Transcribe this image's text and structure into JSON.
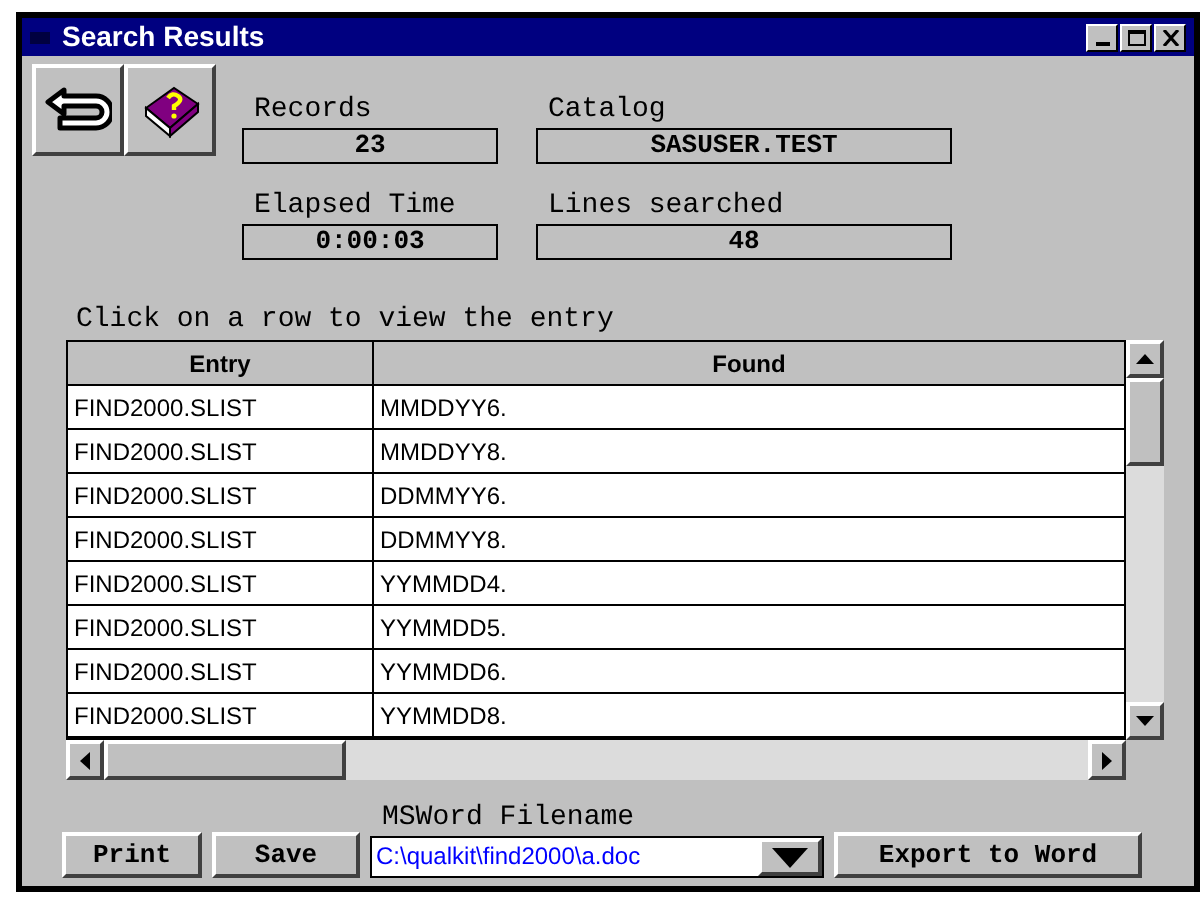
{
  "window": {
    "title": "Search Results"
  },
  "stats": [
    {
      "label": "Records",
      "value": "23"
    },
    {
      "label": "Catalog",
      "value": "SASUSER.TEST"
    },
    {
      "label": "Elapsed Time",
      "value": "0:00:03"
    },
    {
      "label": "Lines searched",
      "value": "48"
    }
  ],
  "instruction": "Click on a row to view the entry",
  "table": {
    "columns": [
      "Entry",
      "Found"
    ],
    "rows": [
      [
        "FIND2000.SLIST",
        "MMDDYY6."
      ],
      [
        "FIND2000.SLIST",
        "MMDDYY8."
      ],
      [
        "FIND2000.SLIST",
        "DDMMYY6."
      ],
      [
        "FIND2000.SLIST",
        "DDMMYY8."
      ],
      [
        "FIND2000.SLIST",
        "YYMMDD4."
      ],
      [
        "FIND2000.SLIST",
        "YYMMDD5."
      ],
      [
        "FIND2000.SLIST",
        "YYMMDD6."
      ],
      [
        "FIND2000.SLIST",
        "YYMMDD8."
      ]
    ]
  },
  "buttons": [
    "Print",
    "Save"
  ],
  "filename": {
    "label": "MSWord Filename",
    "value": "C:\\qualkit\\find2000\\a.doc"
  },
  "export_button": "Export to Word"
}
